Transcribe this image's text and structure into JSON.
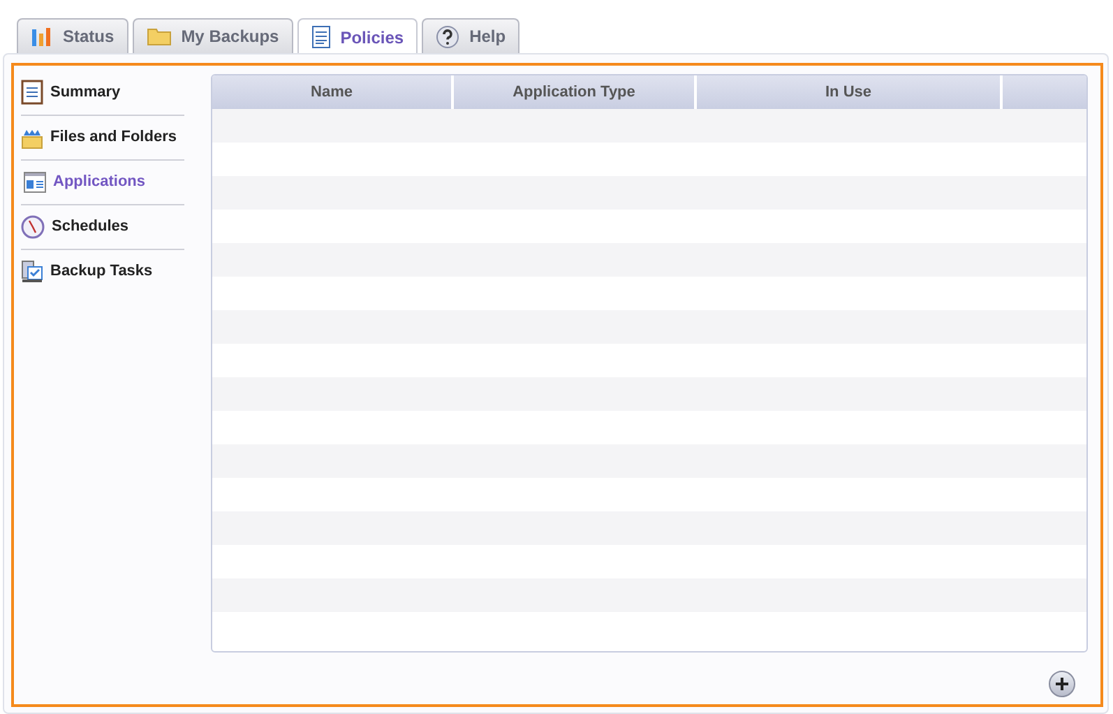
{
  "tabs": [
    {
      "label": "Status",
      "kind": "chart",
      "selected": false
    },
    {
      "label": "My Backups",
      "kind": "folder",
      "selected": false
    },
    {
      "label": "Policies",
      "kind": "document",
      "selected": true
    },
    {
      "label": "Help",
      "kind": "help",
      "selected": false
    }
  ],
  "sidebar": {
    "items": [
      {
        "label": "Summary",
        "kind": "summary",
        "selected": false
      },
      {
        "label": "Files and Folders",
        "kind": "files",
        "selected": false
      },
      {
        "label": "Applications",
        "kind": "applications",
        "selected": true
      },
      {
        "label": "Schedules",
        "kind": "clock",
        "selected": false
      },
      {
        "label": "Backup Tasks",
        "kind": "tasks",
        "selected": false
      }
    ]
  },
  "table": {
    "columns": [
      "Name",
      "Application Type",
      "In Use"
    ]
  }
}
